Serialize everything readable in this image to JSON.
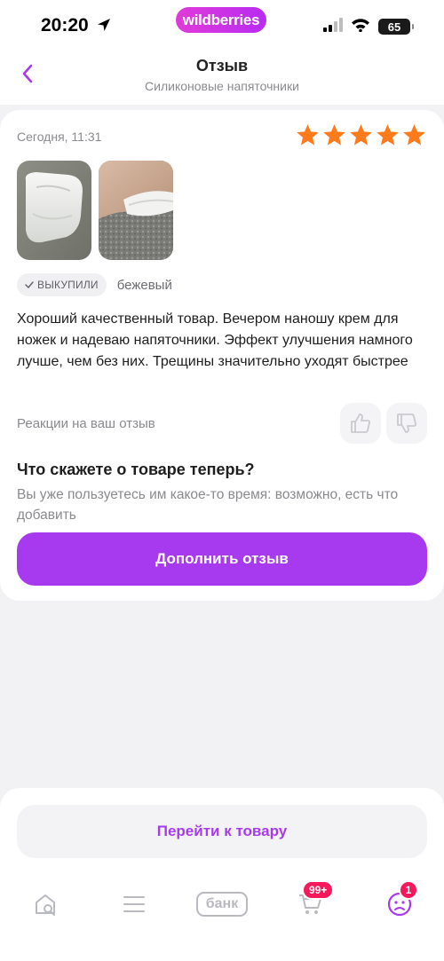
{
  "status_bar": {
    "time": "20:20",
    "brand": "wildberries",
    "battery": "65"
  },
  "header": {
    "title": "Отзыв",
    "subtitle": "Силиконовые напяточники"
  },
  "review": {
    "date": "Сегодня, 11:31",
    "rating": 5,
    "star_color": "#ff7a1a",
    "bought_badge": "ВЫКУПИЛИ",
    "color": "бежевый",
    "text": "Хороший качественный товар. Вечером наношу крем для ножек и надеваю напяточники. Эффект улучшения намного лучше, чем без них. Трещины значительно уходят быстрее",
    "reactions_label": "Реакции на ваш отзыв"
  },
  "follow_up": {
    "title": "Что скажете о товаре теперь?",
    "subtitle": "Вы уже пользуетесь им какое-то время: возможно, есть что добавить",
    "button": "Дополнить отзыв"
  },
  "bottom": {
    "go_to_product": "Перейти к товару"
  },
  "tabbar": {
    "bank_label": "банк",
    "cart_badge": "99+",
    "profile_badge": "1",
    "accent_color": "#a73aee",
    "badge_color": "#f5195b"
  }
}
